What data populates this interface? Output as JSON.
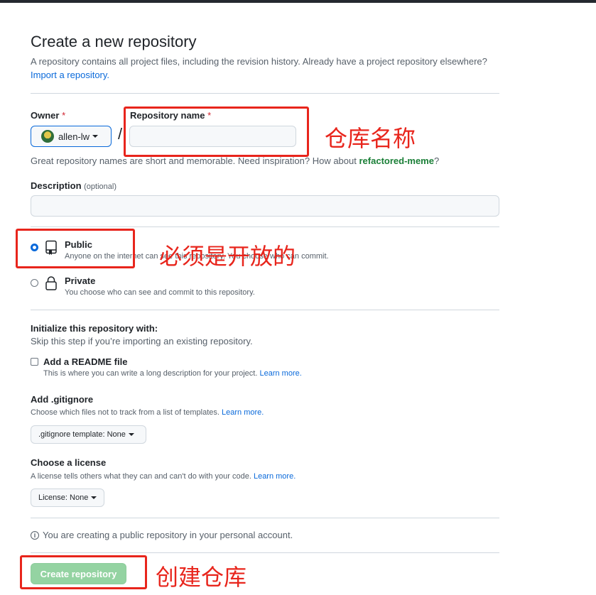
{
  "page": {
    "title": "Create a new repository",
    "subtitle": "A repository contains all project files, including the revision history. Already have a project repository elsewhere?",
    "import_link": "Import a repository."
  },
  "owner": {
    "label": "Owner",
    "required_mark": "*",
    "value": "allen-lw"
  },
  "repo_name": {
    "label": "Repository name",
    "required_mark": "*",
    "value": "",
    "separator": "/"
  },
  "name_hint": {
    "text": "Great repository names are short and memorable. Need inspiration? How about",
    "suggestion": "refactored-meme",
    "suffix": "?"
  },
  "description": {
    "label": "Description",
    "optional": "(optional)",
    "value": ""
  },
  "visibility": {
    "public": {
      "title": "Public",
      "desc": "Anyone on the internet can see this repository. You choose who can commit.",
      "selected": true
    },
    "private": {
      "title": "Private",
      "desc": "You choose who can see and commit to this repository.",
      "selected": false
    }
  },
  "init": {
    "title": "Initialize this repository with:",
    "subtitle": "Skip this step if you’re importing an existing repository.",
    "readme": {
      "label": "Add a README file",
      "desc": "This is where you can write a long description for your project.",
      "learn": "Learn more.",
      "checked": false
    }
  },
  "gitignore": {
    "title": "Add .gitignore",
    "desc": "Choose which files not to track from a list of templates.",
    "learn": "Learn more.",
    "button": ".gitignore template: None"
  },
  "license": {
    "title": "Choose a license",
    "desc": "A license tells others what they can and can't do with your code.",
    "learn": "Learn more.",
    "button": "License: None"
  },
  "notice": "You are creating a public repository in your personal account.",
  "create_button": "Create repository",
  "annotations": {
    "repo_name": "仓库名称",
    "public": "必须是开放的",
    "create": "创建仓库"
  },
  "colors": {
    "annotation_red": "#e8251c",
    "link_blue": "#0969da",
    "create_button_green": "#94d3a2",
    "suggestion_green": "#1a7f37"
  },
  "icons": {
    "public": "repo-icon",
    "private": "lock-icon",
    "info": "info-icon",
    "caret": "triangle-down-icon"
  }
}
